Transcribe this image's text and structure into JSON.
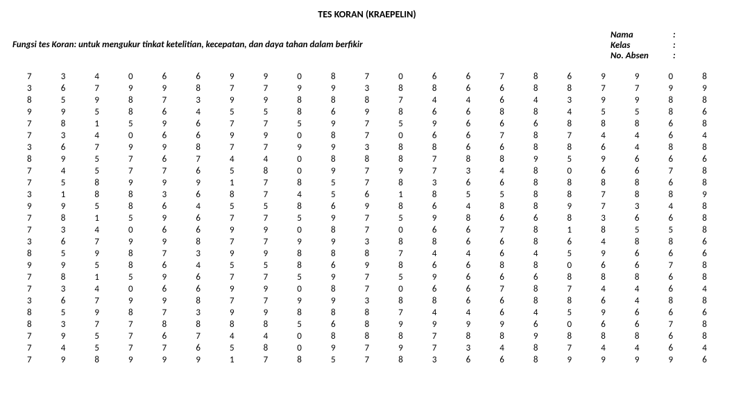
{
  "title": "TES KORAN (KRAEPELIN)",
  "fungsi": "Fungsi tes Koran: untuk mengukur tinkat ketelitian, kecepatan, dan daya tahan dalam berfikir",
  "info": {
    "nama_label": "Nama",
    "kelas_label": "Kelas",
    "absen_label": "No. Absen",
    "colon": ":"
  },
  "grid": [
    [
      7,
      3,
      4,
      0,
      6,
      6,
      9,
      9,
      0,
      8,
      7,
      0,
      6,
      6,
      7,
      8,
      6,
      9,
      9,
      0,
      8
    ],
    [
      3,
      6,
      7,
      9,
      9,
      8,
      7,
      7,
      9,
      9,
      3,
      8,
      8,
      6,
      6,
      8,
      8,
      7,
      7,
      9,
      9
    ],
    [
      8,
      5,
      9,
      8,
      7,
      3,
      9,
      9,
      8,
      8,
      8,
      7,
      4,
      4,
      6,
      4,
      3,
      9,
      9,
      8,
      8
    ],
    [
      9,
      9,
      5,
      8,
      6,
      4,
      5,
      5,
      8,
      6,
      9,
      8,
      6,
      6,
      8,
      8,
      4,
      5,
      5,
      8,
      6
    ],
    [
      7,
      8,
      1,
      5,
      9,
      6,
      7,
      7,
      5,
      9,
      7,
      5,
      9,
      6,
      6,
      6,
      8,
      8,
      8,
      6,
      8
    ],
    [
      7,
      3,
      4,
      0,
      6,
      6,
      9,
      9,
      0,
      8,
      7,
      0,
      6,
      6,
      7,
      8,
      7,
      4,
      4,
      6,
      4
    ],
    [
      3,
      6,
      7,
      9,
      9,
      8,
      7,
      7,
      9,
      9,
      3,
      8,
      8,
      6,
      6,
      8,
      8,
      6,
      4,
      8,
      8
    ],
    [
      8,
      9,
      5,
      7,
      6,
      7,
      4,
      4,
      0,
      8,
      8,
      8,
      7,
      8,
      8,
      9,
      5,
      9,
      6,
      6,
      6
    ],
    [
      7,
      4,
      5,
      7,
      7,
      6,
      5,
      8,
      0,
      9,
      7,
      9,
      7,
      3,
      4,
      8,
      0,
      6,
      6,
      7,
      8
    ],
    [
      7,
      5,
      8,
      9,
      9,
      9,
      1,
      7,
      8,
      5,
      7,
      8,
      3,
      6,
      6,
      8,
      8,
      8,
      8,
      6,
      8
    ],
    [
      3,
      1,
      8,
      8,
      3,
      6,
      8,
      7,
      4,
      5,
      6,
      1,
      8,
      5,
      5,
      8,
      8,
      7,
      8,
      8,
      9
    ],
    [
      9,
      9,
      5,
      8,
      6,
      4,
      5,
      5,
      8,
      6,
      9,
      8,
      6,
      4,
      8,
      8,
      9,
      7,
      3,
      4,
      8
    ],
    [
      7,
      8,
      1,
      5,
      9,
      6,
      7,
      7,
      5,
      9,
      7,
      5,
      9,
      8,
      6,
      6,
      8,
      3,
      6,
      6,
      8
    ],
    [
      7,
      3,
      4,
      0,
      6,
      6,
      9,
      9,
      0,
      8,
      7,
      0,
      6,
      6,
      7,
      8,
      1,
      8,
      5,
      5,
      8
    ],
    [
      3,
      6,
      7,
      9,
      9,
      8,
      7,
      7,
      9,
      9,
      3,
      8,
      8,
      6,
      6,
      8,
      6,
      4,
      8,
      8,
      6
    ],
    [
      8,
      5,
      9,
      8,
      7,
      3,
      9,
      9,
      8,
      8,
      8,
      7,
      4,
      4,
      6,
      4,
      5,
      9,
      6,
      6,
      6
    ],
    [
      9,
      9,
      5,
      8,
      6,
      4,
      5,
      5,
      8,
      6,
      9,
      8,
      6,
      6,
      8,
      8,
      0,
      6,
      6,
      7,
      8
    ],
    [
      7,
      8,
      1,
      5,
      9,
      6,
      7,
      7,
      5,
      9,
      7,
      5,
      9,
      6,
      6,
      6,
      8,
      8,
      8,
      6,
      8
    ],
    [
      7,
      3,
      4,
      0,
      6,
      6,
      9,
      9,
      0,
      8,
      7,
      0,
      6,
      6,
      7,
      8,
      7,
      4,
      4,
      6,
      4
    ],
    [
      3,
      6,
      7,
      9,
      9,
      8,
      7,
      7,
      9,
      9,
      3,
      8,
      8,
      6,
      6,
      8,
      8,
      6,
      4,
      8,
      8
    ],
    [
      8,
      5,
      9,
      8,
      7,
      3,
      9,
      9,
      8,
      8,
      8,
      7,
      4,
      4,
      6,
      4,
      5,
      9,
      6,
      6,
      6
    ],
    [
      8,
      3,
      7,
      7,
      8,
      8,
      8,
      8,
      5,
      6,
      8,
      9,
      9,
      9,
      9,
      6,
      0,
      6,
      6,
      7,
      8
    ],
    [
      7,
      9,
      5,
      7,
      6,
      7,
      4,
      4,
      0,
      8,
      8,
      8,
      7,
      8,
      8,
      9,
      8,
      8,
      8,
      6,
      8
    ],
    [
      7,
      4,
      5,
      7,
      7,
      6,
      5,
      8,
      0,
      9,
      7,
      9,
      7,
      3,
      4,
      8,
      7,
      4,
      4,
      6,
      4
    ],
    [
      7,
      9,
      8,
      9,
      9,
      9,
      1,
      7,
      8,
      5,
      7,
      8,
      3,
      6,
      6,
      8,
      9,
      9,
      9,
      9,
      6
    ]
  ]
}
